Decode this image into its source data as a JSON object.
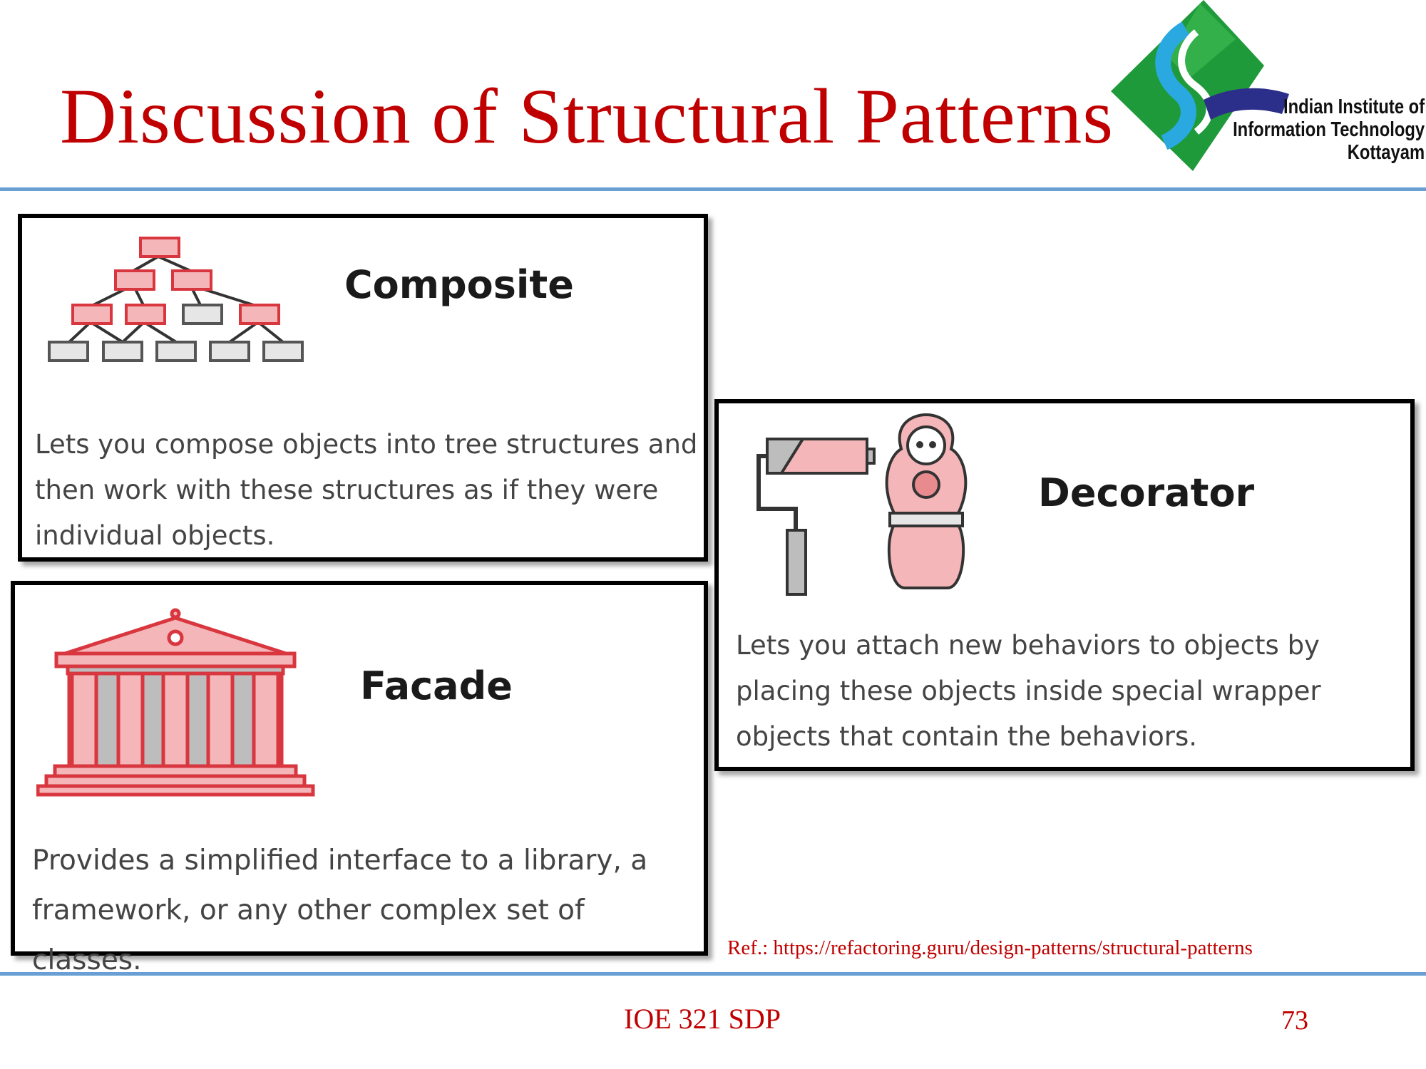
{
  "slide": {
    "title": "Discussion of Structural Patterns",
    "institute": {
      "line1": "Indian Institute of",
      "line2": "Information Technology",
      "line3": "Kottayam"
    },
    "patterns": [
      {
        "name": "Composite",
        "description": "Lets you compose objects into tree structures and then work with these structures as if they were individual objects.",
        "icon": "tree-hierarchy-icon"
      },
      {
        "name": "Facade",
        "description": "Provides a simplified interface to a library, a framework, or any other complex set of classes.",
        "icon": "greek-temple-icon"
      },
      {
        "name": "Decorator",
        "description": "Lets you attach new behaviors to objects by placing these objects inside special wrapper objects that contain the behaviors.",
        "icon": "paint-roller-nesting-doll-icon"
      }
    ],
    "reference": "Ref.: https://refactoring.guru/design-patterns/structural-patterns",
    "footer": {
      "course": "IOE 321 SDP",
      "page": "73"
    },
    "colors": {
      "title": "#c00000",
      "rule": "#6a9fd4",
      "accent_pink": "#f4b6b8",
      "accent_red": "#d9373f"
    }
  }
}
